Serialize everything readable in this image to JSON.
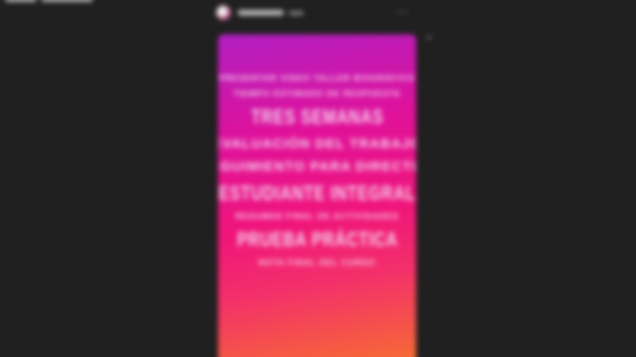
{
  "story": {
    "lines": [
      "PRESENTAR VIDEO TALLER BIOGRÁFICO",
      "TIEMPO ESTIMADO DE RESPUESTA",
      "TRES SEMANAS",
      "EVALUACIÓN DEL TRABAJO",
      "SEGUIMIENTO PARA DIRECTOR",
      "ESTUDIANTE INTEGRAL",
      "RESUMEN FINAL DE ACTIVIDADES",
      "PRUEBA PRÁCTICA",
      "NOTA FINAL DEL CURSO"
    ]
  },
  "colors": {
    "background": "#202020",
    "gradient_top": "#b21fc2",
    "gradient_mid": "#f0157a",
    "gradient_bottom": "#f7712e",
    "text": "#f6d6ee"
  }
}
